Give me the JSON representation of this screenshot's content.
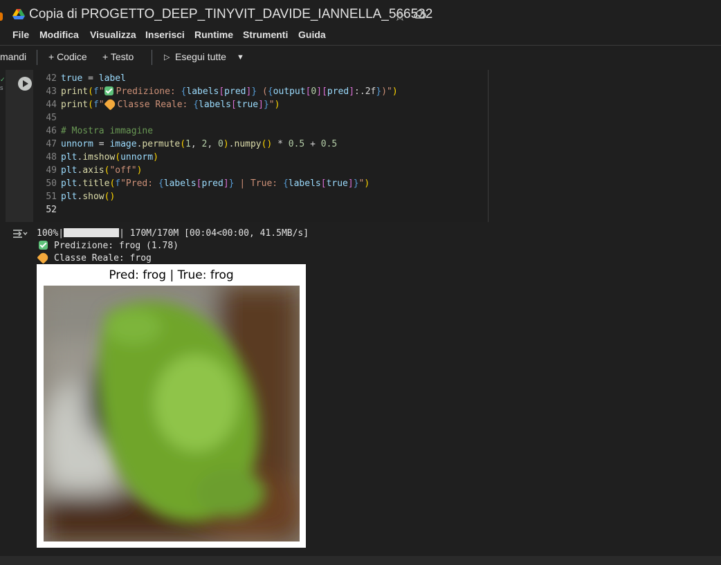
{
  "app": {
    "title": "Copia di PROGETTO_DEEP_TINYVIT_DAVIDE_IANNELLA_566532",
    "icons": [
      "google-drive-icon",
      "star-icon",
      "cloud-saved-icon"
    ]
  },
  "menu": [
    "File",
    "Modifica",
    "Visualizza",
    "Inserisci",
    "Runtime",
    "Strumenti",
    "Guida"
  ],
  "toolbar": {
    "commands_label": "mandi",
    "add_code": "+ Codice",
    "add_text": "+ Testo",
    "run_all": "Esegui tutte"
  },
  "cell": {
    "left_fragment": [
      "✓",
      "s"
    ],
    "code_lines": [
      {
        "n": "42",
        "text": "true = label"
      },
      {
        "n": "43",
        "text": "print(f\"✅ Predizione: {labels[pred]} ({output[0][pred]:.2f})\")"
      },
      {
        "n": "44",
        "text": "print(f\"🏷️ Classe Reale: {labels[true]}\")"
      },
      {
        "n": "45",
        "text": ""
      },
      {
        "n": "46",
        "text": "# Mostra immagine"
      },
      {
        "n": "47",
        "text": "unnorm = image.permute(1, 2, 0).numpy() * 0.5 + 0.5"
      },
      {
        "n": "48",
        "text": "plt.imshow(unnorm)"
      },
      {
        "n": "49",
        "text": "plt.axis(\"off\")"
      },
      {
        "n": "50",
        "text": "plt.title(f\"Pred: {labels[pred]} | True: {labels[true]}\")"
      },
      {
        "n": "51",
        "text": "plt.show()"
      },
      {
        "n": "52",
        "text": ""
      }
    ]
  },
  "output": {
    "progress_percent": "100%|",
    "progress_fraction": 1.0,
    "progress_rest": "| 170M/170M [00:04<00:00, 41.5MB/s]",
    "prediction_line": "Predizione: frog (1.78)",
    "true_class_line": "Classe Reale: frog",
    "figure_title": "Pred: frog | True: frog"
  },
  "colors": {
    "background": "#1f1f1f",
    "editor": "#1e1e1e",
    "frog_green": "#7fb23a",
    "drive_yellow": "#fbbc04",
    "drive_green": "#34a853",
    "drive_blue": "#4285f4"
  }
}
